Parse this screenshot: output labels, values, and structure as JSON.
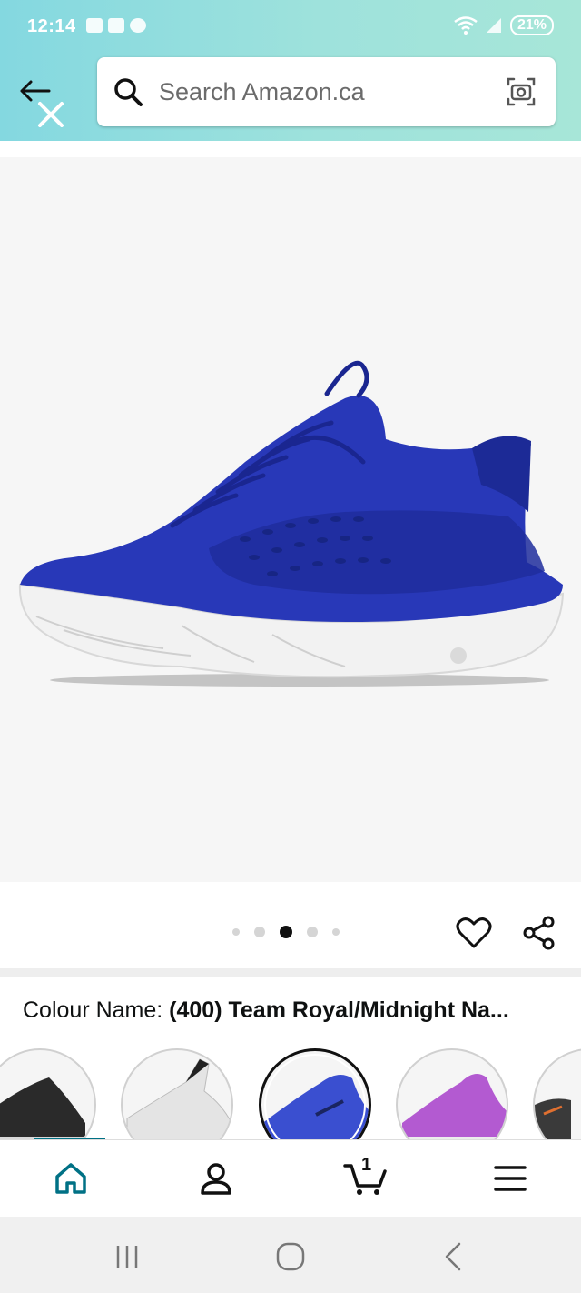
{
  "status_bar": {
    "time": "12:14",
    "battery": "21%"
  },
  "search": {
    "placeholder": "Search Amazon.ca"
  },
  "product_image": {
    "page_count": 5,
    "current_page": 3,
    "description_color": "#2838b8"
  },
  "colour": {
    "label": "Colour Name: ",
    "value": "(400) Team Royal/Midnight Na..."
  },
  "swatches": [
    {
      "name": "black",
      "color": "#2a2a2a",
      "selected": false
    },
    {
      "name": "white",
      "color": "#e8e8e8",
      "selected": false
    },
    {
      "name": "royal",
      "color": "#3a4fd0",
      "selected": true
    },
    {
      "name": "purple",
      "color": "#b35ad1",
      "selected": false
    },
    {
      "name": "dark",
      "color": "#3a3a3a",
      "selected": false
    }
  ],
  "bottom_nav": {
    "cart_count": "1",
    "items": [
      "home-icon",
      "account-icon",
      "cart-icon",
      "menu-icon"
    ]
  },
  "colors": {
    "header_bg": "#9ee2dc",
    "teal_accent": "#007185",
    "image_bg": "#f6f6f6"
  }
}
